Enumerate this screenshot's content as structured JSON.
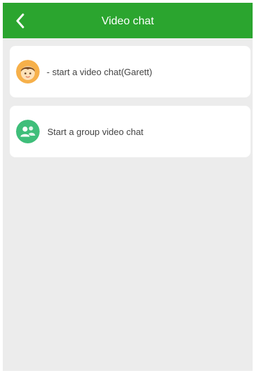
{
  "header": {
    "title": "Video chat",
    "back_icon": "chevron-left-icon",
    "background_color": "#2ba52f"
  },
  "options": [
    {
      "label": "- start a video chat(Garett)",
      "icon": "child-avatar-icon",
      "icon_color": "#f6b04a"
    },
    {
      "label": "Start a group video chat",
      "icon": "group-people-icon",
      "icon_color": "#3fbe7a"
    }
  ],
  "page_background": "#ececec"
}
